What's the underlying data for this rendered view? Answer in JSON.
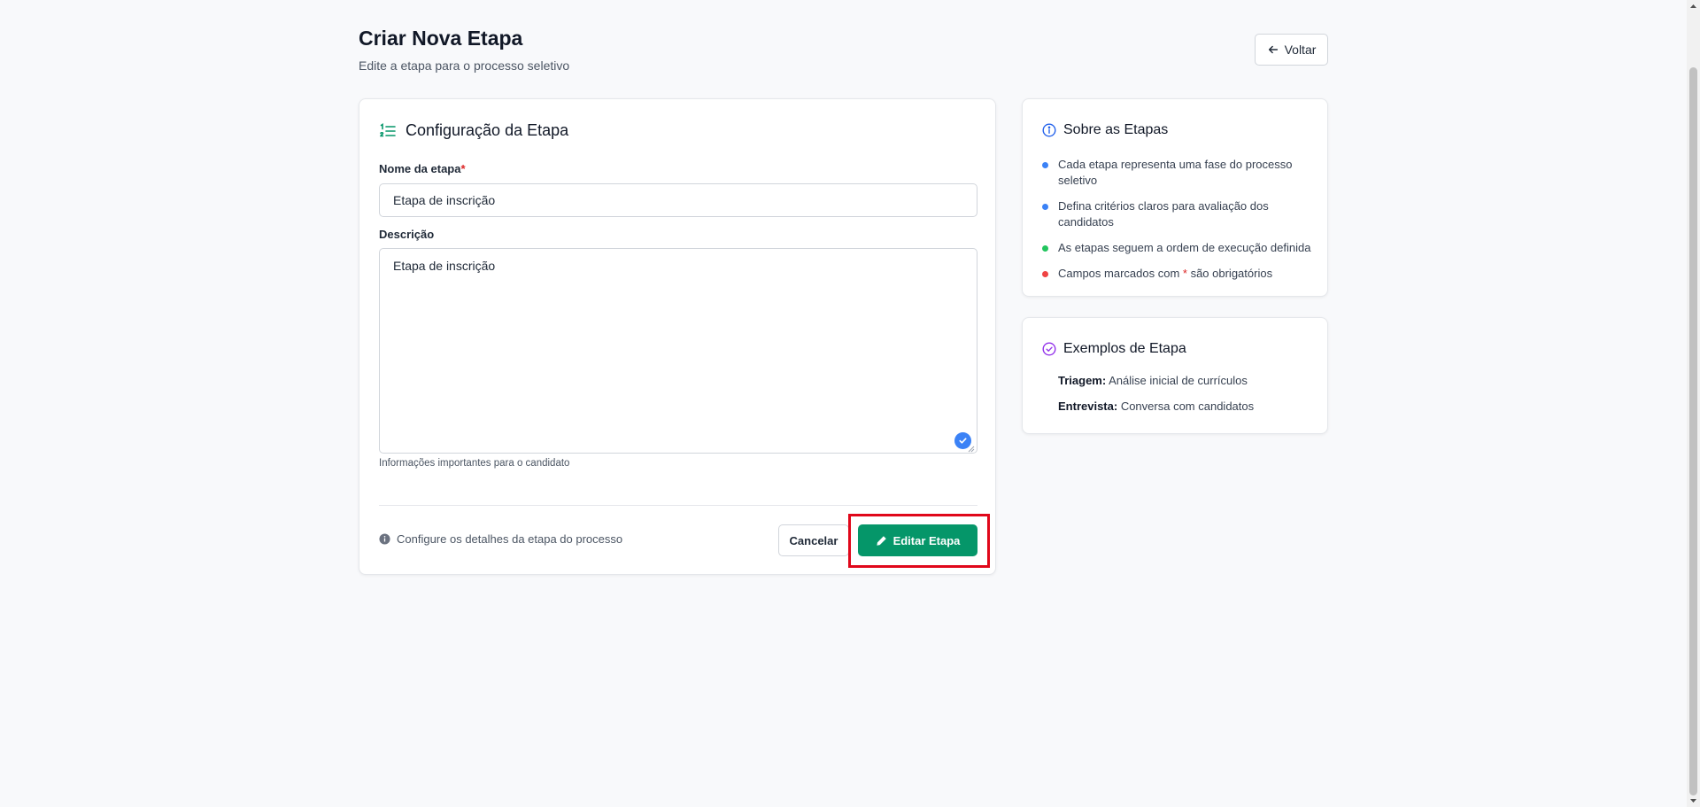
{
  "header": {
    "title": "Criar Nova Etapa",
    "subtitle": "Edite a etapa para o processo seletivo",
    "back_label": "Voltar"
  },
  "form": {
    "card_title": "Configuração da Etapa",
    "name_label": "Nome da etapa",
    "required_mark": "*",
    "name_value": "Etapa de inscrição",
    "description_label": "Descrição",
    "description_value": "Etapa de inscrição ",
    "description_help": "Informações importantes para o candidato",
    "footer_info": "Configure os detalhes da etapa do processo",
    "cancel_label": "Cancelar",
    "submit_label": "Editar Etapa"
  },
  "info": {
    "title": "Sobre as Etapas",
    "items": [
      {
        "text": "Cada etapa representa uma fase do processo seletivo",
        "color": "#3b82f6"
      },
      {
        "text": "Defina critérios claros para avaliação dos candidatos",
        "color": "#3b82f6"
      },
      {
        "text": "As etapas seguem a ordem de execução definida",
        "color": "#22c55e"
      },
      {
        "pre": "Campos marcados com ",
        "mark": "*",
        "post": " são obrigatórios",
        "color": "#ef4444"
      }
    ]
  },
  "examples": {
    "title": "Exemplos de Etapa",
    "items": [
      {
        "name": "Triagem:",
        "desc": " Análise inicial de currículos"
      },
      {
        "name": "Entrevista:",
        "desc": " Conversa com candidatos"
      }
    ]
  },
  "colors": {
    "accent_green": "#059669",
    "info_blue": "#2563eb",
    "examples_purple": "#9333ea",
    "highlight_red": "#e0071a"
  }
}
